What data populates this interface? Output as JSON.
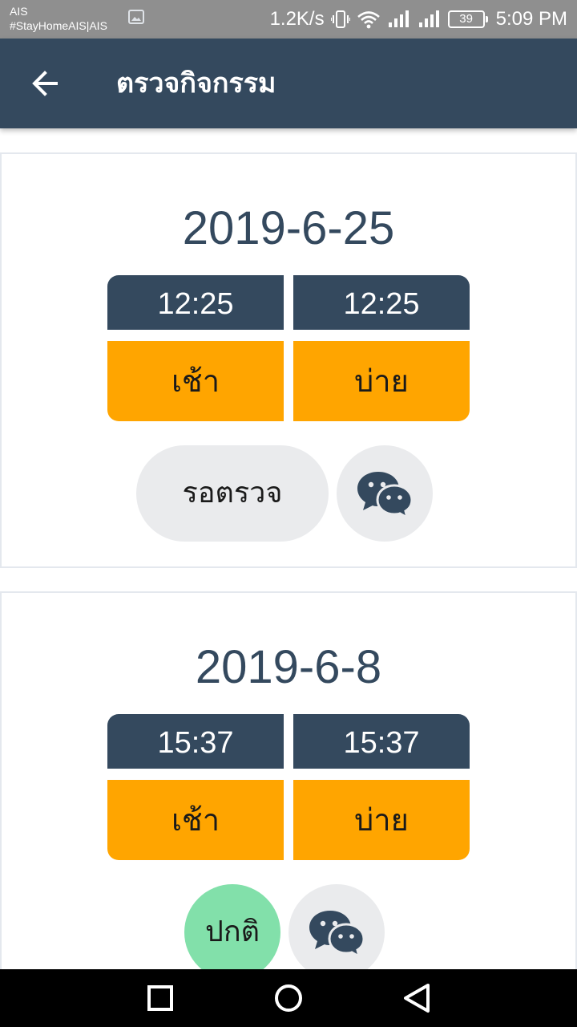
{
  "status_bar": {
    "carrier_line1": "AIS",
    "carrier_line2": "#StayHomeAIS|AIS",
    "net_speed": "1.2K/s",
    "battery": "39",
    "time": "5:09 PM"
  },
  "app_bar": {
    "title": "ตรวจกิจกรรม",
    "back_icon": "arrow-left-icon"
  },
  "records": [
    {
      "date": "2019-6-25",
      "time_in": "12:25",
      "time_out": "12:25",
      "shift_in": "เช้า",
      "shift_out": "บ่าย",
      "status": "รอตรวจ"
    },
    {
      "date": "2019-6-8",
      "time_in": "15:37",
      "time_out": "15:37",
      "shift_in": "เช้า",
      "shift_out": "บ่าย",
      "status": "ปกติ"
    }
  ],
  "colors": {
    "primary": "#34495e",
    "shift": "#ffa500",
    "pending_pill": "#eaebed",
    "normal_pill": "#82e0aa"
  }
}
